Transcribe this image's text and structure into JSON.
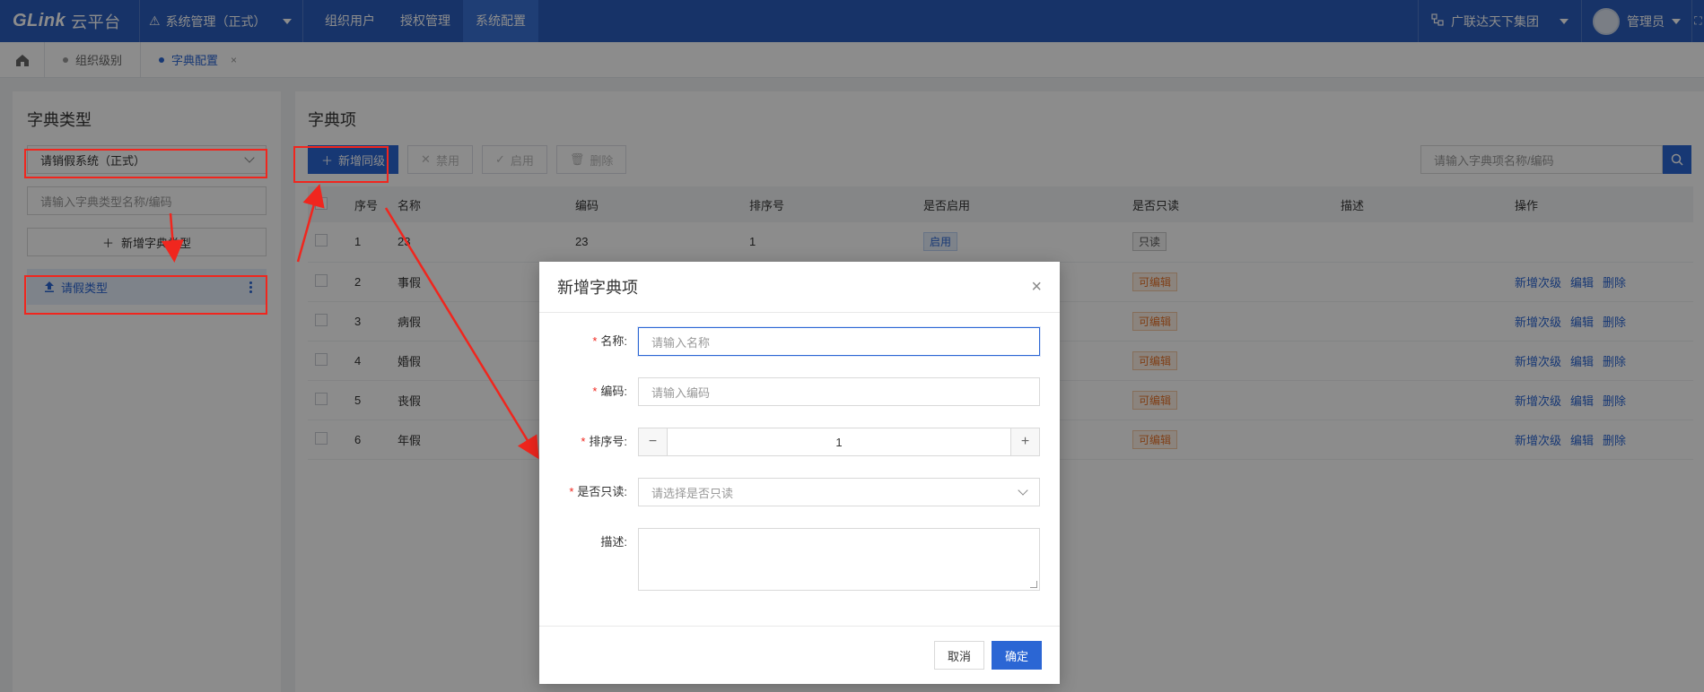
{
  "topbar": {
    "logo": "GLink",
    "logo_suffix": "云平台",
    "system_select": "系统管理（正式）",
    "nav": [
      {
        "label": "组织用户"
      },
      {
        "label": "授权管理"
      },
      {
        "label": "系统配置"
      }
    ],
    "org_select": "广联达天下集团",
    "user_name": "管理员"
  },
  "tabstrip": {
    "tabs": [
      {
        "label": "组织级别"
      },
      {
        "label": "字典配置"
      }
    ],
    "close_glyph": "×"
  },
  "left_panel": {
    "title": "字典类型",
    "system_select": "请销假系统（正式）",
    "search_placeholder": "请输入字典类型名称/编码",
    "add_button": "新增字典类型",
    "tree_item": "请假类型"
  },
  "right_panel": {
    "title": "字典项",
    "toolbar": {
      "add_peer": "新增同级",
      "disable": "禁用",
      "enable": "启用",
      "delete": "删除"
    },
    "search_placeholder": "请输入字典项名称/编码",
    "table": {
      "headers": [
        "序号",
        "名称",
        "编码",
        "排序号",
        "是否启用",
        "是否只读",
        "描述",
        "操作"
      ],
      "rows": [
        {
          "index": "1",
          "name": "23",
          "code": "23",
          "sort": "1",
          "enabled": "启用",
          "readonly": "只读",
          "desc": "",
          "ops": []
        },
        {
          "index": "2",
          "name": "事假",
          "readonly": "可编辑",
          "ops": [
            "新增次级",
            "编辑",
            "删除"
          ]
        },
        {
          "index": "3",
          "name": "病假",
          "readonly": "可编辑",
          "ops": [
            "新增次级",
            "编辑",
            "删除"
          ]
        },
        {
          "index": "4",
          "name": "婚假",
          "readonly": "可编辑",
          "ops": [
            "新增次级",
            "编辑",
            "删除"
          ]
        },
        {
          "index": "5",
          "name": "丧假",
          "readonly": "可编辑",
          "ops": [
            "新增次级",
            "编辑",
            "删除"
          ]
        },
        {
          "index": "6",
          "name": "年假",
          "readonly": "可编辑",
          "ops": [
            "新增次级",
            "编辑",
            "删除"
          ]
        }
      ]
    }
  },
  "modal": {
    "title": "新增字典项",
    "fields": {
      "name_label": "名称:",
      "name_placeholder": "请输入名称",
      "code_label": "编码:",
      "code_placeholder": "请输入编码",
      "sort_label": "排序号:",
      "sort_value": "1",
      "readonly_label": "是否只读:",
      "readonly_placeholder": "请选择是否只读",
      "desc_label": "描述:"
    },
    "required_mark": "*",
    "cancel": "取消",
    "confirm": "确定"
  },
  "colors": {
    "primary": "#2b66d4",
    "topbar": "#2b5ebd",
    "annotation_red": "#f0261e"
  }
}
